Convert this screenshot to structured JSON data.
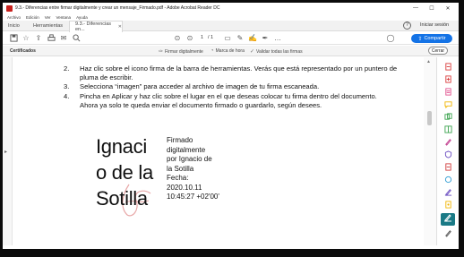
{
  "window": {
    "title": "9.3.- Diferencias entre firmar digitalmente y crear un mensaje_Firmado.pdf - Adobe Acrobat Reader DC",
    "controls": [
      "—",
      "☐",
      "✕"
    ]
  },
  "menu": [
    "Archivo",
    "Edición",
    "Ver",
    "Ventana",
    "Ayuda"
  ],
  "tabs": [
    {
      "label": "Inicio"
    },
    {
      "label": "Herramientas"
    },
    {
      "label": "9.3.- Diferencias en...",
      "close": "✕"
    }
  ],
  "account": {
    "signin": "Iniciar sesión",
    "help": "?"
  },
  "toolbar": {
    "page_current": "1",
    "page_total": "/ 1",
    "share_label": "Compartir"
  },
  "certbar": {
    "label": "Certificados",
    "tools": [
      "Firmar digitalmente",
      "Marca de hora",
      "Validar todas las firmas"
    ],
    "close_label": "Cerrar"
  },
  "document": {
    "steps": [
      {
        "num": "2.",
        "text": "Haz clic sobre el icono firma de la barra de herramientas. Verás que está representado por un puntero de",
        "cont": "pluma de escribir."
      },
      {
        "num": "3.",
        "text": "Selecciona “imagen” para acceder al archivo de imagen de tu firma escaneada."
      },
      {
        "num": "4.",
        "text": "Pincha en Aplicar y haz clic sobre el lugar en el que deseas colocar tu firma dentro del documento.",
        "cont": "Ahora ya solo te queda enviar el documento firmado o guardarlo, según desees."
      }
    ],
    "signature": {
      "name_lines": [
        "Ignaci",
        "o de la",
        "Sotilla"
      ],
      "detail_lines": [
        "Firmado",
        "digitalmente",
        "por Ignacio de",
        "la Sotilla",
        "Fecha:",
        "2020.10.11",
        "10:45:27 +02'00'"
      ]
    }
  },
  "right_panel": {
    "icons": [
      {
        "name": "export-pdf-icon",
        "color": "#d83b3b"
      },
      {
        "name": "create-pdf-icon",
        "color": "#d83b3b"
      },
      {
        "name": "edit-pdf-icon",
        "color": "#e04e8c"
      },
      {
        "name": "comment-icon",
        "color": "#f0b400"
      },
      {
        "name": "combine-icon",
        "color": "#3ba34e"
      },
      {
        "name": "organize-icon",
        "color": "#3ba34e"
      },
      {
        "name": "fill-sign-icon",
        "color": "#c0388a"
      },
      {
        "name": "protect-icon",
        "color": "#6b4ec1"
      },
      {
        "name": "compress-icon",
        "color": "#d03a3a"
      },
      {
        "name": "scan-icon",
        "color": "#2d9bd2"
      },
      {
        "name": "send-icon",
        "color": "#6b4ec1"
      },
      {
        "name": "more-tools-icon",
        "color": "#f0b400"
      },
      {
        "name": "certificates-icon",
        "color": "#1a7a86"
      },
      {
        "name": "settings-icon",
        "color": "#555555"
      }
    ]
  }
}
